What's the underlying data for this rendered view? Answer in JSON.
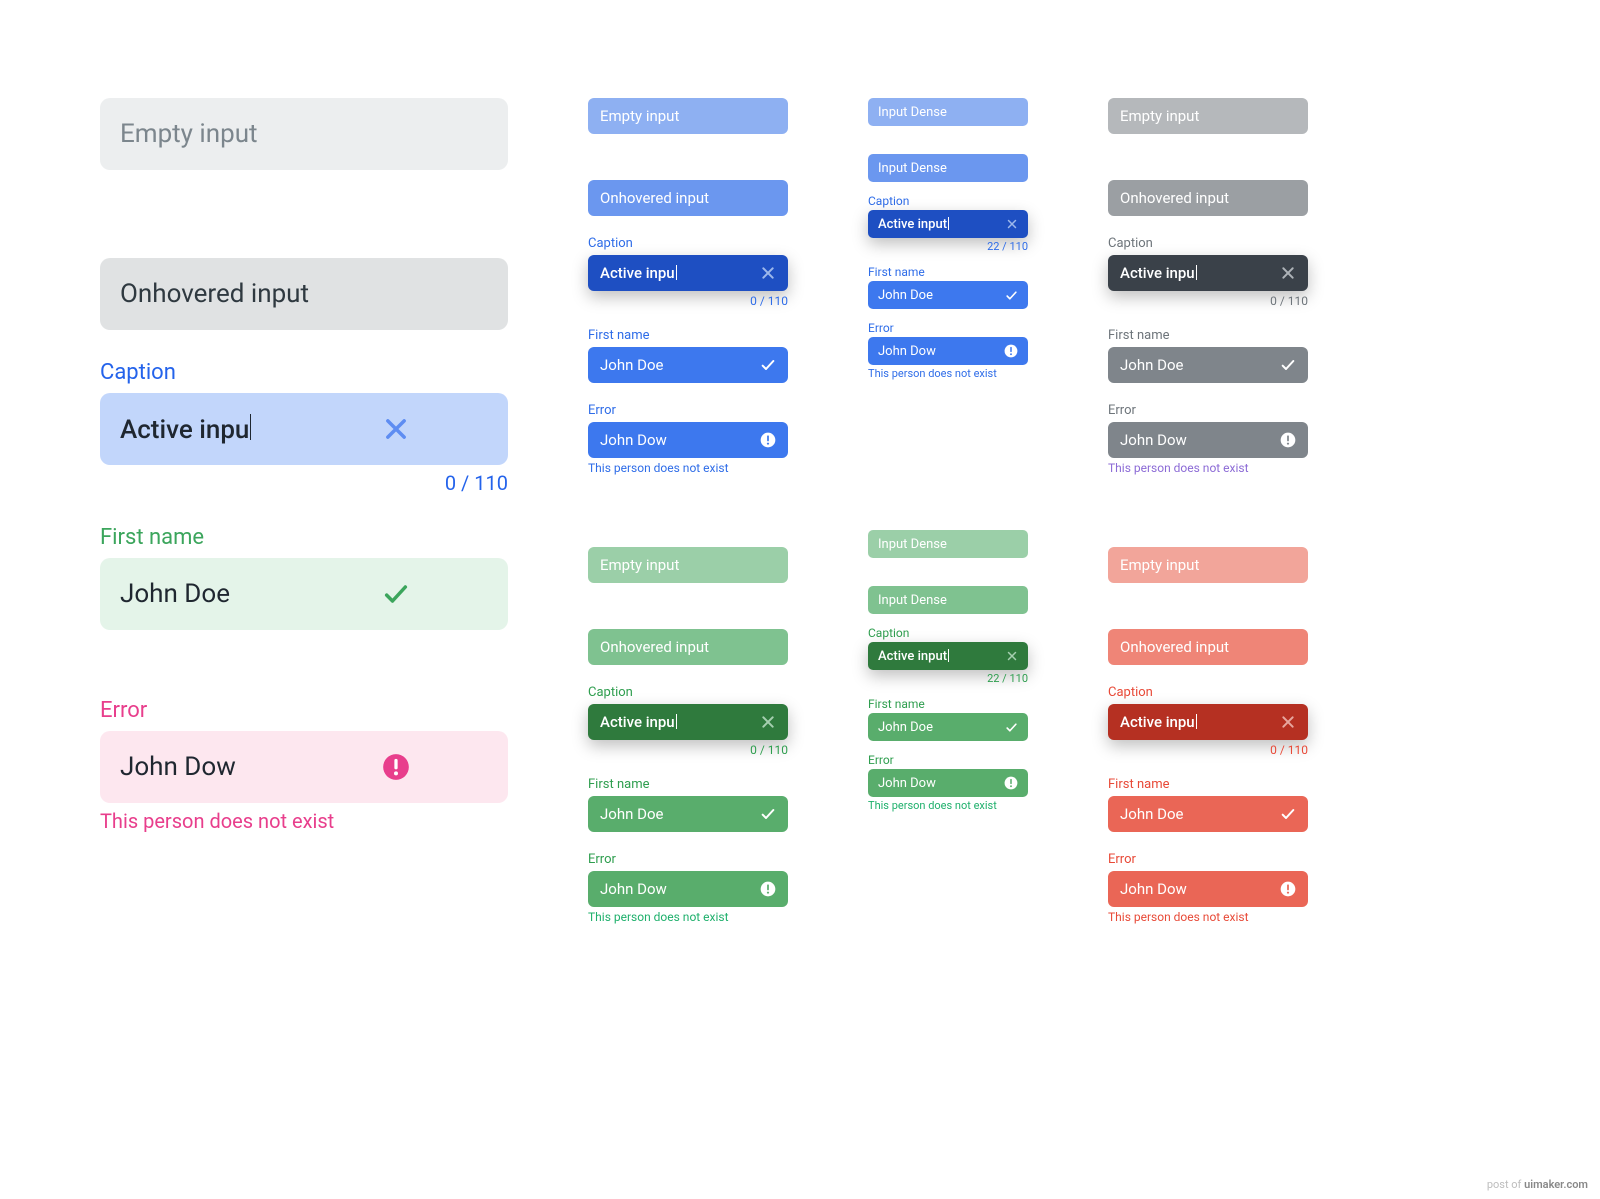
{
  "labels": {
    "empty": "Empty input",
    "hover": "Onhovered input",
    "caption": "Caption",
    "first_name": "First name",
    "error": "Error",
    "dense": "Input Dense"
  },
  "values": {
    "active": "Active inpu",
    "active_full": "Active input",
    "valid": "John Doe",
    "error_val": "John Dow"
  },
  "helper": {
    "error": "This person does not exist"
  },
  "counter": {
    "zero": "0 / 110",
    "nz": "22 / 110"
  },
  "colors": {
    "lg_default_bg": "#eceeef",
    "lg_hover_bg": "#e0e2e3",
    "lg_caption_blue": "#2463eb",
    "lg_active_bg": "#c2d6fb",
    "lg_close_blue": "#5e8df2",
    "lg_caption_green": "#3ba55c",
    "lg_valid_bg": "#e4f4e9",
    "lg_caption_pink": "#e83e8c",
    "lg_error_bg": "#fde7ef",
    "lg_text": "#2f3940",
    "lg_placeholder": "#7c868d",
    "blue_light": "#8eb0f2",
    "blue_hover": "#6b97ef",
    "blue_dark": "#1e4fc2",
    "blue_mid": "#3d78ee",
    "blue_text": "#2f6de8",
    "gray_light": "#b5b8bb",
    "gray_hover": "#9b9fa3",
    "gray_dark": "#3a4149",
    "gray_mid": "#7f858b",
    "gray_text": "#6e757b",
    "green_light": "#9bcfa8",
    "green_hover": "#7fc290",
    "green_dark": "#2f7a3d",
    "green_mid": "#59ad6c",
    "green_text": "#2f9e4f",
    "green_help": "#1fb06c",
    "red_light": "#f2a59a",
    "red_hover": "#ef8577",
    "red_dark": "#b53022",
    "red_mid": "#ea6656",
    "red_text": "#e84a38"
  },
  "watermark": {
    "pre": "post of ",
    "site": "uimaker.com"
  }
}
